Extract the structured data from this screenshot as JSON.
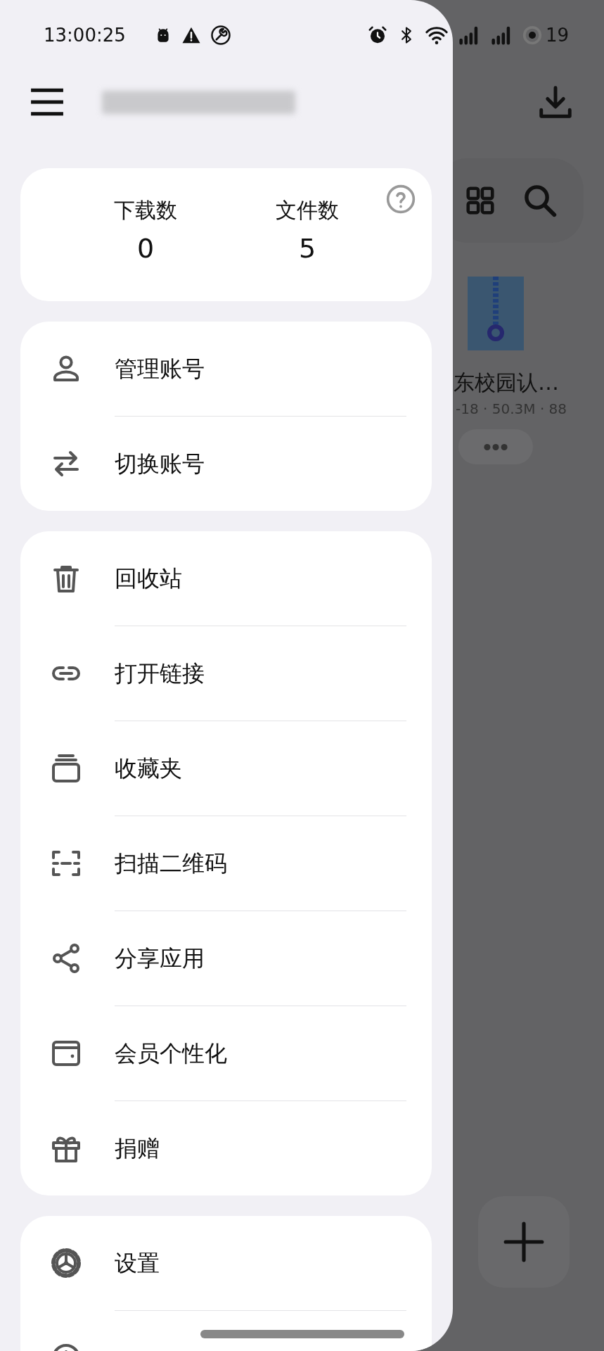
{
  "status_bar": {
    "time": "13:00:25",
    "battery": "19"
  },
  "stats": [
    {
      "label": "下载数",
      "value": "0"
    },
    {
      "label": "文件数",
      "value": "5"
    }
  ],
  "menu_groups": [
    {
      "items": [
        {
          "label": "管理账号"
        },
        {
          "label": "切换账号"
        }
      ]
    },
    {
      "items": [
        {
          "label": "回收站"
        },
        {
          "label": "打开链接"
        },
        {
          "label": "收藏夹"
        },
        {
          "label": "扫描二维码"
        },
        {
          "label": "分享应用"
        },
        {
          "label": "会员个性化"
        },
        {
          "label": "捐赠"
        }
      ]
    },
    {
      "items": [
        {
          "label": "设置"
        },
        {
          "kind": "cut_off"
        }
      ]
    }
  ],
  "background": {
    "file": {
      "title": "东校园认…",
      "meta": "-18 · 50.3M · 88"
    }
  }
}
